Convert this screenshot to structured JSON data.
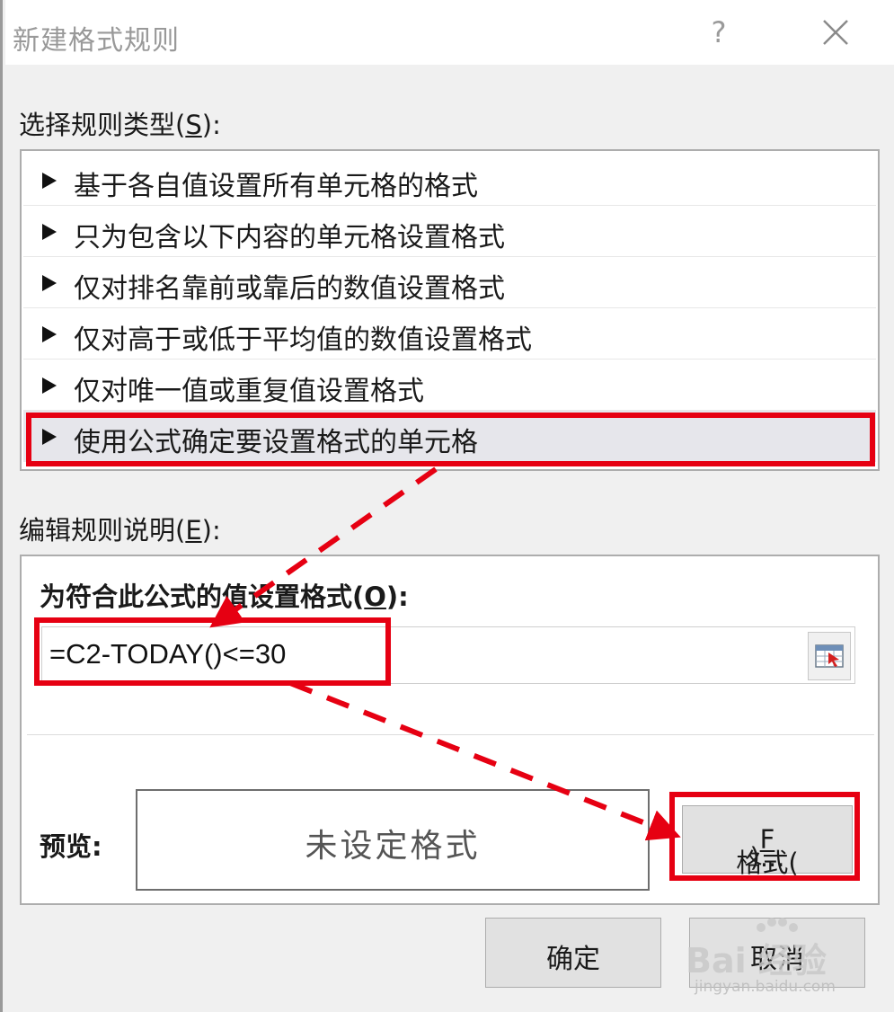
{
  "window": {
    "title": "新建格式规则",
    "help_label": "?",
    "close_icon": "close-icon"
  },
  "rule_type": {
    "label_prefix": "选择规则类型(",
    "label_key": "S",
    "label_suffix": "):",
    "items": [
      {
        "label": "基于各自值设置所有单元格的格式"
      },
      {
        "label": "只为包含以下内容的单元格设置格式"
      },
      {
        "label": "仅对排名靠前或靠后的数值设置格式"
      },
      {
        "label": "仅对高于或低于平均值的数值设置格式"
      },
      {
        "label": "仅对唯一值或重复值设置格式"
      },
      {
        "label": "使用公式确定要设置格式的单元格",
        "selected": true
      }
    ]
  },
  "rule_description": {
    "label_prefix": "编辑规则说明(",
    "label_key": "E",
    "label_suffix": "):",
    "formula_heading_prefix": "为符合此公式的值设置格式(",
    "formula_heading_key": "O",
    "formula_heading_suffix": "):",
    "formula_value": "=C2-TODAY()<=30",
    "range_selector_icon": "range-select-icon",
    "preview_label": "预览:",
    "preview_text": "未设定格式",
    "format_button_prefix": "格式(",
    "format_button_key": "F",
    "format_button_suffix": ")..."
  },
  "buttons": {
    "ok": "确定",
    "cancel": "取消"
  },
  "annotation": {
    "color": "#e60012"
  },
  "watermark": {
    "main": "Bai 经验",
    "sub": "jingyan.baidu.com"
  }
}
